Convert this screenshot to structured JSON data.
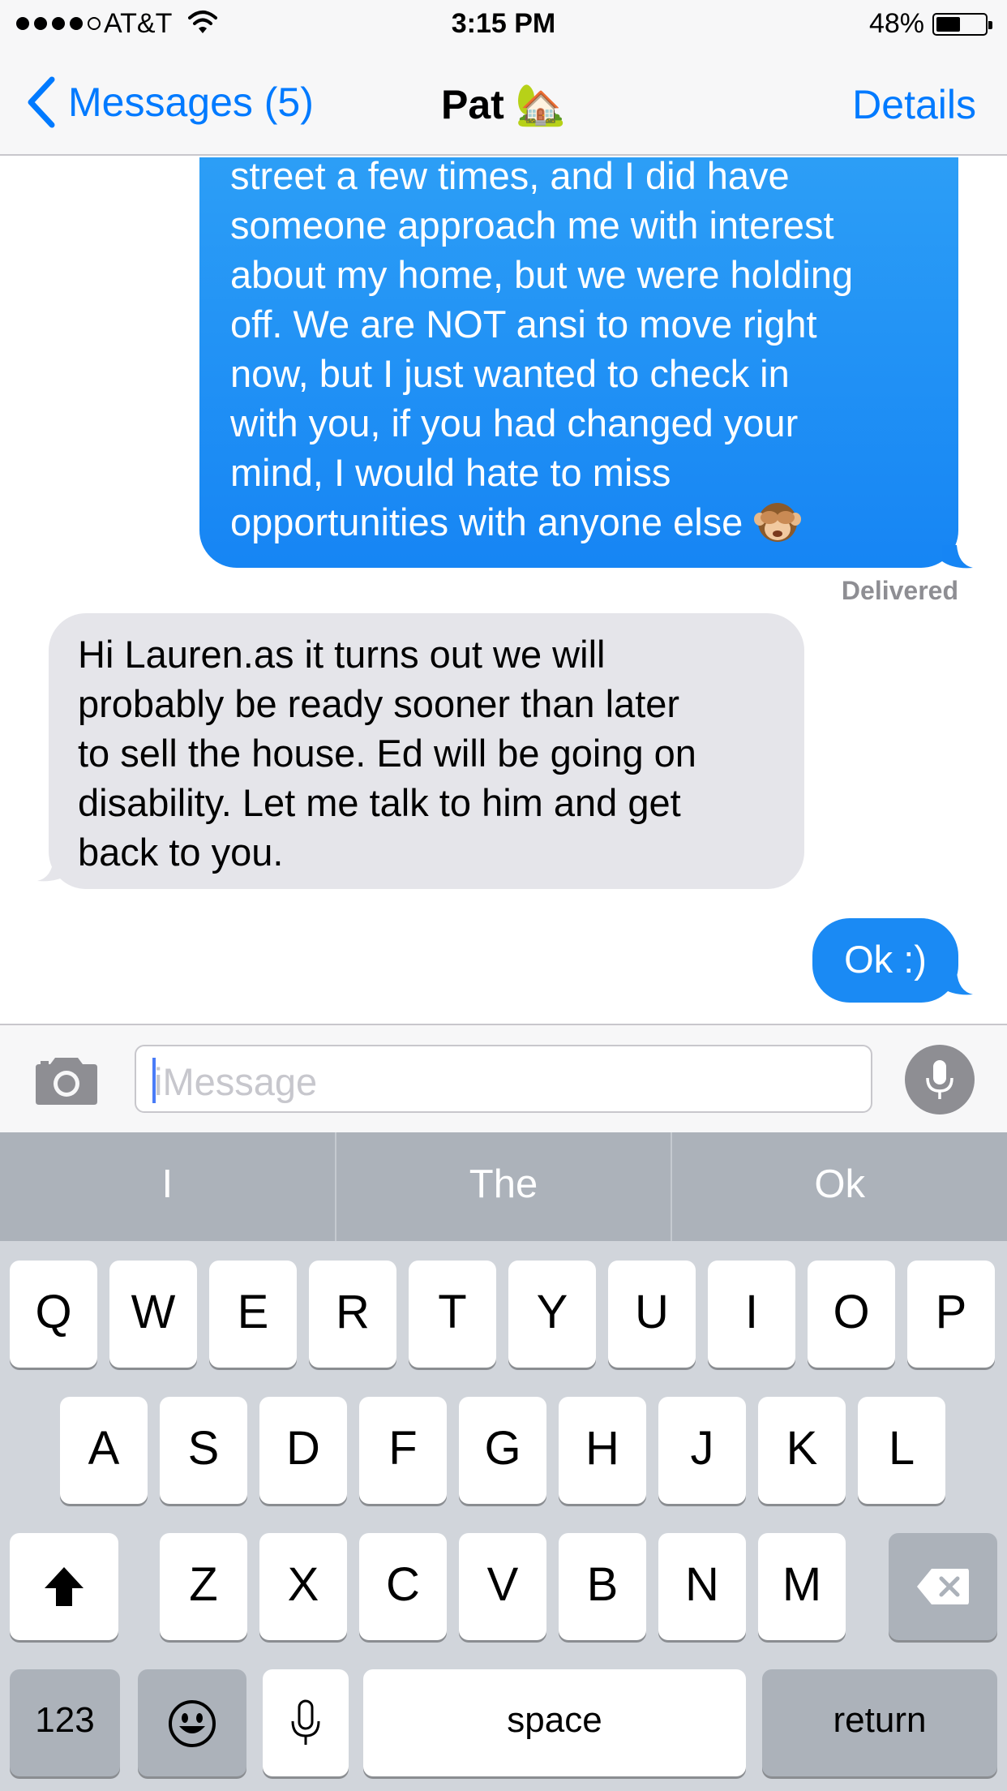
{
  "status": {
    "carrier": "AT&T",
    "time": "3:15 PM",
    "battery_pct": "48%",
    "battery_level": 0.48
  },
  "nav": {
    "back_label": "Messages (5)",
    "title": "Pat 🏡",
    "details_label": "Details"
  },
  "messages": [
    {
      "direction": "sent",
      "lines": [
        "street a few times, and I did have",
        "someone approach me with interest",
        "about my home, but we were holding",
        "off. We are NOT ansi to move right",
        "now, but I just wanted to check in",
        "with you, if you had changed your",
        "mind, I would hate to miss",
        "opportunities with anyone else"
      ],
      "emoji": "see-no-evil-monkey",
      "status": "Delivered"
    },
    {
      "direction": "received",
      "lines": [
        "Hi Lauren.as it turns out we will",
        "probably be ready sooner than later",
        "to sell the house. Ed will be going on",
        "disability. Let me talk to him and get",
        "back to you."
      ]
    },
    {
      "direction": "sent",
      "text": "Ok :)"
    }
  ],
  "input": {
    "placeholder": "iMessage"
  },
  "predictions": [
    "I",
    "The",
    "Ok"
  ],
  "keyboard": {
    "row1": [
      "Q",
      "W",
      "E",
      "R",
      "T",
      "Y",
      "U",
      "I",
      "O",
      "P"
    ],
    "row2": [
      "A",
      "S",
      "D",
      "F",
      "G",
      "H",
      "J",
      "K",
      "L"
    ],
    "row3": [
      "Z",
      "X",
      "C",
      "V",
      "B",
      "N",
      "M"
    ],
    "numbers_label": "123",
    "space_label": "space",
    "return_label": "return"
  },
  "colors": {
    "accent": "#007aff",
    "sent_bubble": "#1a8af4",
    "received_bubble": "#e5e5ea"
  }
}
